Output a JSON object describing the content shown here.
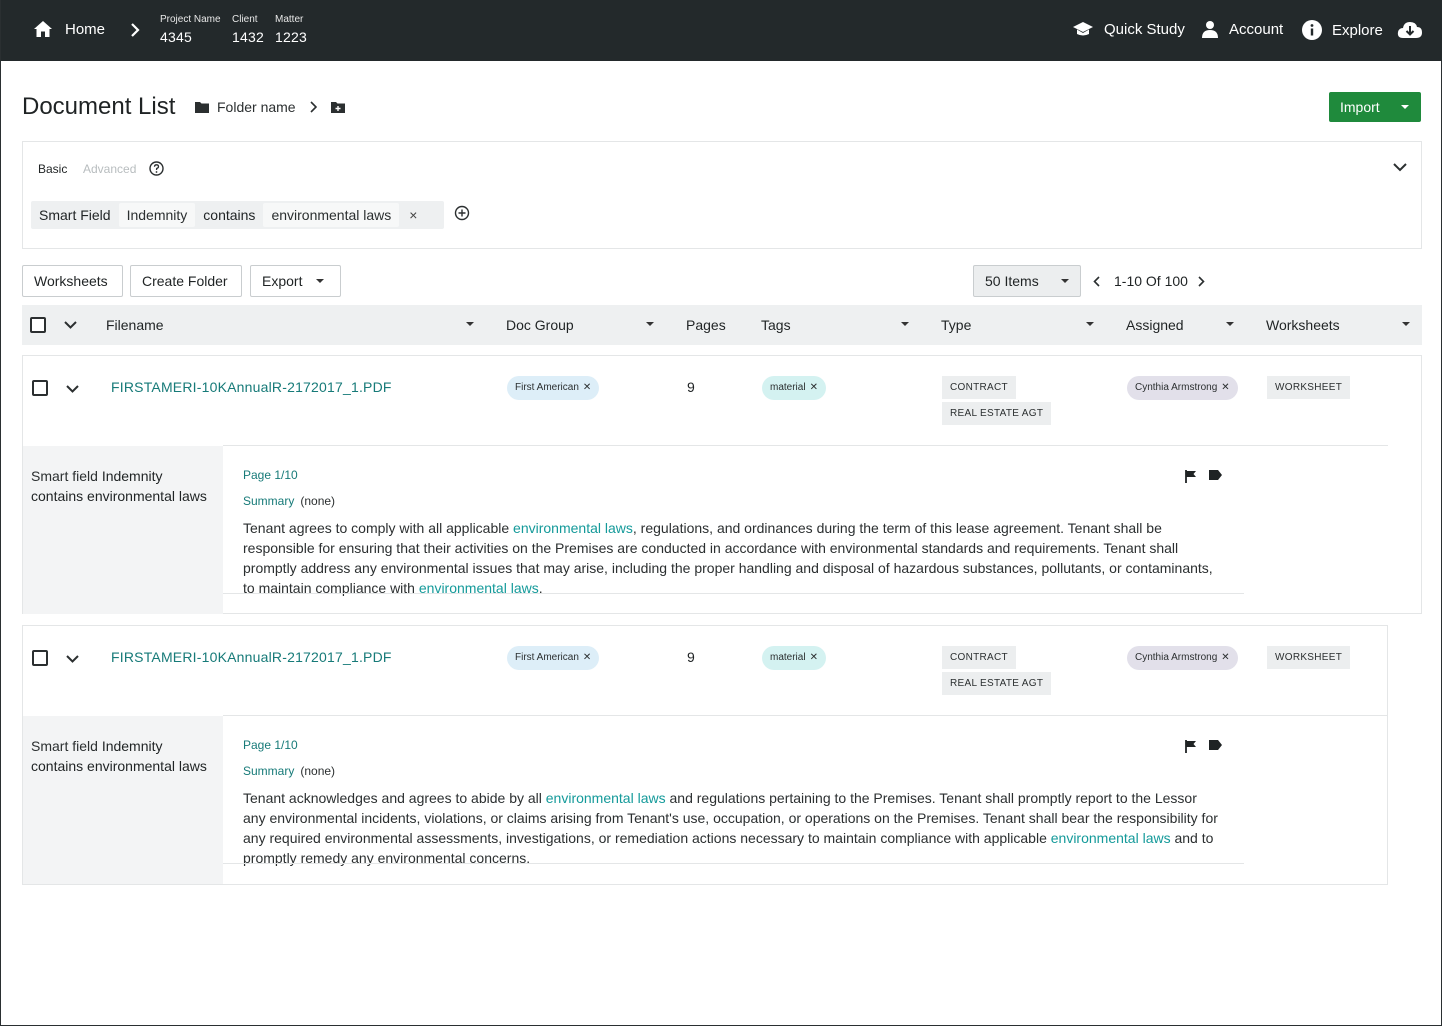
{
  "topbar": {
    "home_label": "Home",
    "meta": [
      {
        "key": "Project Name",
        "value": "4345"
      },
      {
        "key": "Client",
        "value": "1432"
      },
      {
        "key": "Matter",
        "value": "1223"
      }
    ],
    "nav": [
      {
        "label": "Quick Study",
        "icon": "graduation-cap-icon"
      },
      {
        "label": "Account",
        "icon": "user-icon"
      },
      {
        "label": "Explore",
        "icon": "info-icon"
      }
    ]
  },
  "header": {
    "title": "Document List",
    "folder_name": "Folder name",
    "import_label": "Import"
  },
  "filter": {
    "tab_basic": "Basic",
    "tab_advanced": "Advanced",
    "field_type": "Smart Field",
    "field_name": "Indemnity",
    "operator": "contains",
    "value": "environmental laws",
    "remove": "×"
  },
  "toolbar": {
    "worksheets": "Worksheets",
    "create_folder": "Create Folder",
    "export": "Export",
    "items_per_page": "50 Items",
    "range": "1-10 Of 100"
  },
  "columns": {
    "filename": "Filename",
    "doc_group": "Doc Group",
    "pages": "Pages",
    "tags": "Tags",
    "type": "Type",
    "assigned": "Assigned",
    "worksheets": "Worksheets"
  },
  "documents": [
    {
      "filename": "FIRSTAMERI-10KAnnualR-2172017_1.PDF",
      "doc_group": "First American",
      "pages": "9",
      "tag": "material",
      "types": [
        "CONTRACT",
        "REAL ESTATE AGT"
      ],
      "assigned": "Cynthia Armstrong",
      "worksheet": "WORKSHEET",
      "match": {
        "pre": "Smart field",
        "field": "Indemnity",
        "rest": "contains environmental laws",
        "page": "Page 1/10",
        "summary_label": "Summary",
        "summary_value": "(none)",
        "snippet": [
          {
            "t": "Tenant agrees to comply with all applicable ",
            "h": false
          },
          {
            "t": "environmental laws",
            "h": true
          },
          {
            "t": ", regulations, and ordinances during the term of this lease agreement. Tenant shall be responsible for ensuring that their activities on the Premises are conducted in accordance with environmental standards and requirements. Tenant shall promptly address any environmental issues that may arise, including the proper handling and disposal of hazardous substances, pollutants, or contaminants, to maintain compliance with ",
            "h": false
          },
          {
            "t": "environmental laws",
            "h": true
          },
          {
            "t": ".",
            "h": false
          }
        ]
      }
    },
    {
      "filename": "FIRSTAMERI-10KAnnualR-2172017_1.PDF",
      "doc_group": "First American",
      "pages": "9",
      "tag": "material",
      "types": [
        "CONTRACT",
        "REAL ESTATE AGT"
      ],
      "assigned": "Cynthia Armstrong",
      "worksheet": "WORKSHEET",
      "match": {
        "pre": "Smart field",
        "field": "Indemnity",
        "rest": "contains environmental laws",
        "page": "Page 1/10",
        "summary_label": "Summary",
        "summary_value": "(none)",
        "snippet": [
          {
            "t": "Tenant acknowledges and agrees to abide by all ",
            "h": false
          },
          {
            "t": "environmental laws",
            "h": true
          },
          {
            "t": " and regulations pertaining to the Premises. Tenant shall promptly report to the Lessor any environmental incidents, violations, or claims arising from Tenant's use, occupation, or operations on the Premises. Tenant shall bear the responsibility for any required environmental assessments, investigations, or remediation actions necessary to maintain compliance with applicable ",
            "h": false
          },
          {
            "t": "environmental laws",
            "h": true
          },
          {
            "t": " and to promptly remedy any environmental concerns.",
            "h": false
          }
        ]
      }
    }
  ],
  "colors": {
    "topbar": "#23292b",
    "accent_green": "#1f8a3c",
    "link_teal": "#167a78",
    "highlight": "#149a9a"
  }
}
